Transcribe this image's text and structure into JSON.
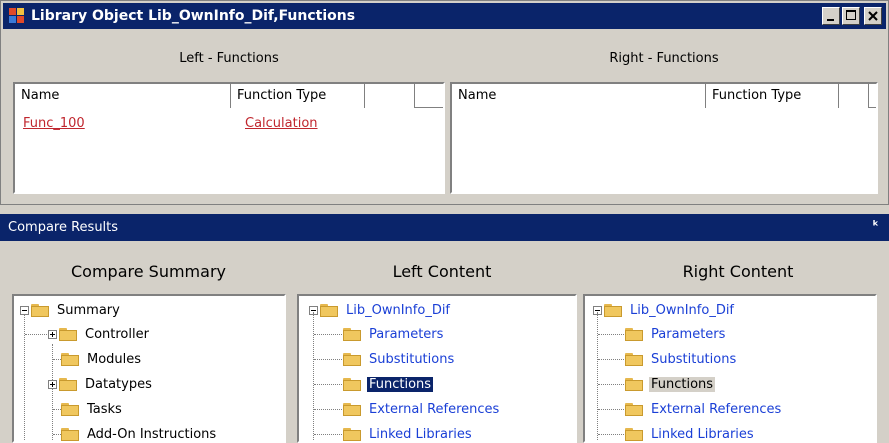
{
  "window": {
    "title": "Library Object Lib_OwnInfo_Dif,Functions",
    "buttons": [
      "minimize",
      "maximize",
      "close"
    ]
  },
  "left_pane": {
    "label": "Left - Functions",
    "columns": [
      "Name",
      "Function Type"
    ],
    "rows": [
      {
        "name": "Func_100",
        "type": "Calculation"
      }
    ]
  },
  "right_pane": {
    "label": "Right - Functions",
    "columns": [
      "Name",
      "Function Type"
    ],
    "rows": []
  },
  "results": {
    "title": "Compare Results",
    "pin_icon": "pin-icon",
    "summary": {
      "heading": "Compare Summary",
      "root": "Summary",
      "items": [
        "Controller",
        "Modules",
        "Datatypes",
        "Tasks",
        "Add-On Instructions"
      ]
    },
    "left_content": {
      "heading": "Left Content",
      "root": "Lib_OwnInfo_Dif",
      "items": [
        "Parameters",
        "Substitutions",
        "Functions",
        "External References",
        "Linked Libraries"
      ],
      "selected": "Functions"
    },
    "right_content": {
      "heading": "Right Content",
      "root": "Lib_OwnInfo_Dif",
      "items": [
        "Parameters",
        "Substitutions",
        "Functions",
        "External References",
        "Linked Libraries"
      ],
      "selected": "Functions"
    }
  },
  "colors": {
    "title_bar": "#0a246a",
    "diff_text": "#c0262e",
    "link_text": "#1a3fd6",
    "folder": "#f0c75e"
  }
}
